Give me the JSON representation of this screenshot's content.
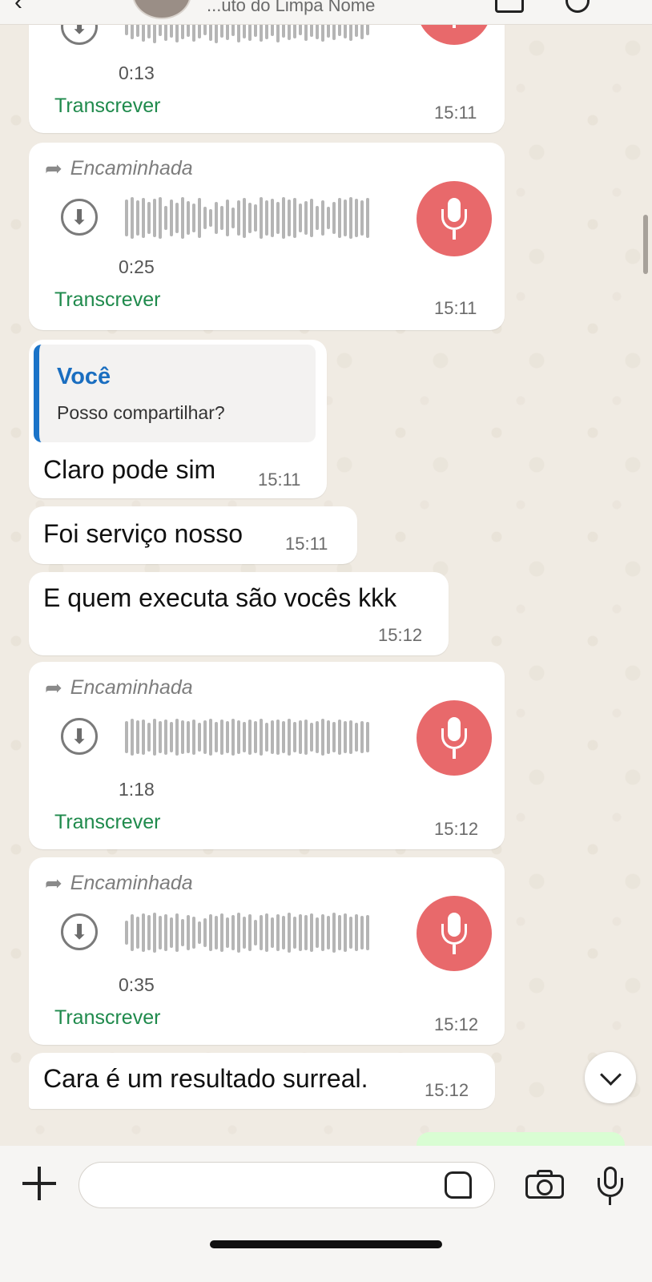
{
  "header": {
    "contact_name": "...uto do Limpa Nome"
  },
  "messages": {
    "m1": {
      "duration": "0:13",
      "transcribe": "Transcrever",
      "time": "15:11"
    },
    "m2": {
      "forwarded": "Encaminhada",
      "duration": "0:25",
      "transcribe": "Transcrever",
      "time": "15:11"
    },
    "m3": {
      "quote_author": "Você",
      "quote_text": "Posso compartilhar?",
      "text": "Claro pode sim",
      "time": "15:11"
    },
    "m4": {
      "text": "Foi serviço nosso",
      "time": "15:11"
    },
    "m5": {
      "text": "E quem executa são vocês kkk",
      "time": "15:12"
    },
    "m6": {
      "forwarded": "Encaminhada",
      "duration": "1:18",
      "transcribe": "Transcrever",
      "time": "15:12"
    },
    "m7": {
      "forwarded": "Encaminhada",
      "duration": "0:35",
      "transcribe": "Transcrever",
      "time": "15:12"
    },
    "m8": {
      "text": "Cara é um resultado surreal.",
      "time": "15:12"
    }
  },
  "input": {
    "placeholder": ""
  },
  "colors": {
    "accent_green": "#1f8a4c",
    "mic_red": "#e8696b",
    "quote_blue": "#1a6ec0"
  },
  "icons": [
    "back-arrow-icon",
    "video-call-icon",
    "phone-icon",
    "forward-icon",
    "download-icon",
    "microphone-icon",
    "chevron-down-icon",
    "plus-icon",
    "sticker-icon",
    "camera-icon"
  ]
}
